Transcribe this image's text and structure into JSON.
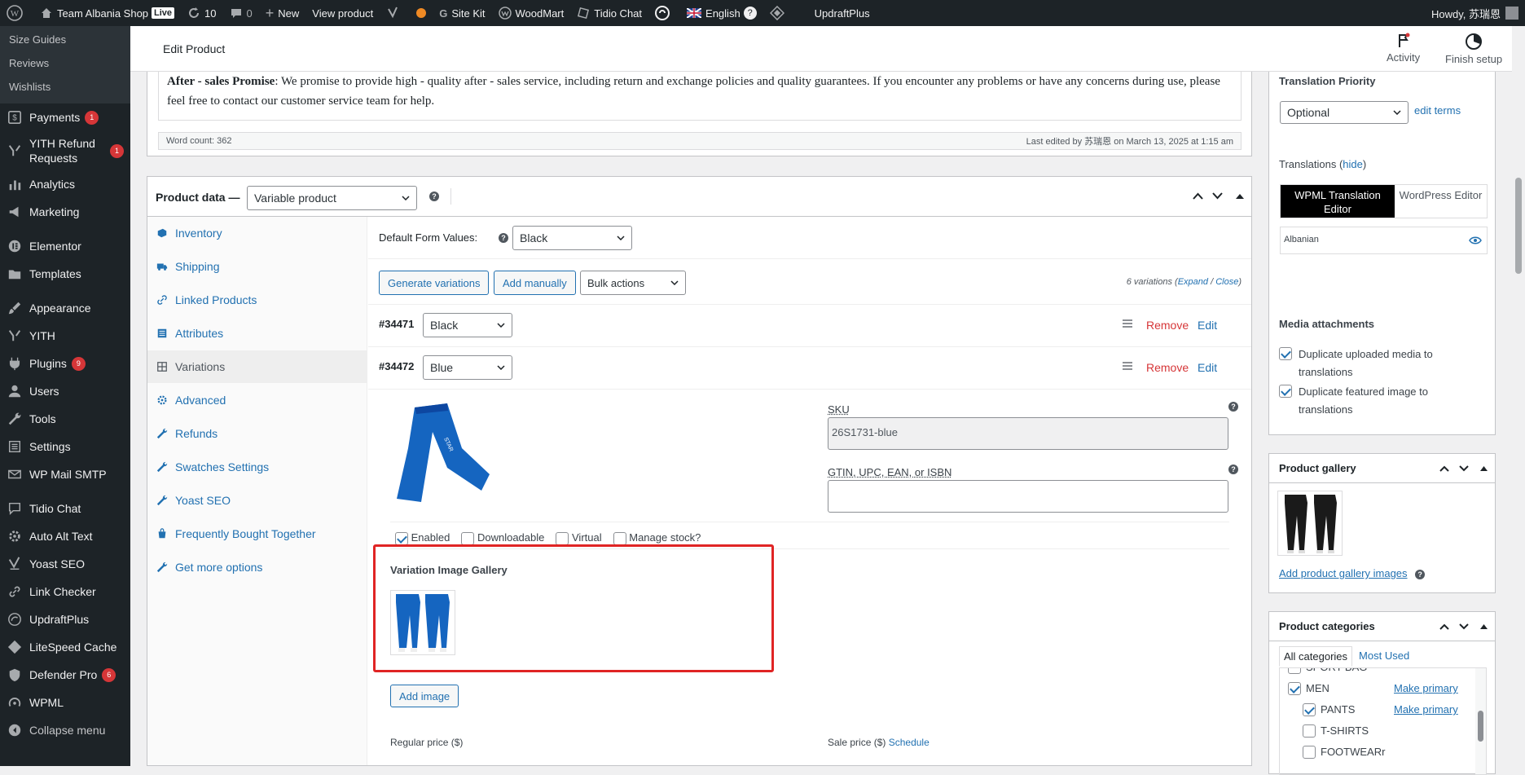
{
  "adminbar": {
    "site": "Team Albania Shop",
    "live": "Live",
    "updates": "10",
    "comments": "0",
    "new": "New",
    "view_product": "View product",
    "site_kit": "Site Kit",
    "woodmart": "WoodMart",
    "tidio": "Tidio Chat",
    "lang": "English",
    "updraft": "UpdraftPlus",
    "howdy": "Howdy, 苏瑞恩"
  },
  "sidebar": {
    "sub": [
      "Size Guides",
      "Reviews",
      "Wishlists"
    ],
    "items": [
      {
        "label": "Payments",
        "badge": "1",
        "icon": "payments-icon"
      },
      {
        "label": "YITH Refund Requests",
        "badge": "1",
        "icon": "yith-icon"
      },
      {
        "label": "Analytics",
        "badge": "",
        "icon": "analytics-icon"
      },
      {
        "label": "Marketing",
        "badge": "",
        "icon": "megaphone-icon"
      },
      {
        "label": "Elementor",
        "badge": "",
        "icon": "elementor-icon"
      },
      {
        "label": "Templates",
        "badge": "",
        "icon": "folder-icon"
      },
      {
        "label": "Appearance",
        "badge": "",
        "icon": "brush-icon"
      },
      {
        "label": "YITH",
        "badge": "",
        "icon": "yith-icon"
      },
      {
        "label": "Plugins",
        "badge": "9",
        "icon": "plug-icon"
      },
      {
        "label": "Users",
        "badge": "",
        "icon": "user-icon"
      },
      {
        "label": "Tools",
        "badge": "",
        "icon": "wrench-icon"
      },
      {
        "label": "Settings",
        "badge": "",
        "icon": "settings-icon"
      },
      {
        "label": "WP Mail SMTP",
        "badge": "",
        "icon": "mail-icon"
      },
      {
        "label": "Tidio Chat",
        "badge": "",
        "icon": "chat-icon"
      },
      {
        "label": "Auto Alt Text",
        "badge": "",
        "icon": "gear-icon"
      },
      {
        "label": "Yoast SEO",
        "badge": "",
        "icon": "yoast-icon"
      },
      {
        "label": "Link Checker",
        "badge": "",
        "icon": "link-icon"
      },
      {
        "label": "UpdraftPlus",
        "badge": "",
        "icon": "updraft-icon"
      },
      {
        "label": "LiteSpeed Cache",
        "badge": "",
        "icon": "diamond-icon"
      },
      {
        "label": "Defender Pro",
        "badge": "6",
        "icon": "shield-icon"
      },
      {
        "label": "WPML",
        "badge": "",
        "icon": "wpml-icon"
      },
      {
        "label": "Collapse menu",
        "badge": "",
        "icon": "collapse-icon"
      }
    ]
  },
  "topbar": {
    "title": "Edit Product",
    "activity": "Activity",
    "finish": "Finish setup"
  },
  "editor": {
    "promise_bold": "After - sales Promise",
    "promise_text": ": We promise to provide high - quality after - sales service, including return and exchange policies and quality guarantees. If you encounter any problems or have any concerns during use, please feel free to contact our customer service team for help.",
    "word_count": "Word count: 362",
    "last_edited": "Last edited by 苏瑞恩 on March 13, 2025 at 1:15 am"
  },
  "product_data": {
    "label": "Product data —",
    "type": "Variable product",
    "tabs": [
      {
        "label": "Inventory",
        "icon": "inventory-icon"
      },
      {
        "label": "Shipping",
        "icon": "truck-icon"
      },
      {
        "label": "Linked Products",
        "icon": "link-icon"
      },
      {
        "label": "Attributes",
        "icon": "list-icon"
      },
      {
        "label": "Variations",
        "icon": "grid-icon"
      },
      {
        "label": "Advanced",
        "icon": "gear-icon"
      },
      {
        "label": "Refunds",
        "icon": "wrench-icon"
      },
      {
        "label": "Swatches Settings",
        "icon": "wrench-icon"
      },
      {
        "label": "Yoast SEO",
        "icon": "wrench-icon"
      },
      {
        "label": "Frequently Bought Together",
        "icon": "bag-icon"
      },
      {
        "label": "Get more options",
        "icon": "wrench-icon"
      }
    ],
    "default_form": "Default Form Values:",
    "default_value": "Black",
    "generate": "Generate variations",
    "add_manually": "Add manually",
    "bulk": "Bulk actions",
    "count_text": "6 variations",
    "expand": "Expand",
    "sep": "/",
    "close": "Close",
    "paren_open": "(",
    "paren_close": ")",
    "variations": [
      {
        "id": "#34471",
        "value": "Black"
      },
      {
        "id": "#34472",
        "value": "Blue"
      }
    ],
    "remove": "Remove",
    "edit": "Edit",
    "sku_label": "SKU",
    "sku_value": "26S1731-blue",
    "gtin_label": "GTIN, UPC, EAN, or ISBN",
    "enabled": "Enabled",
    "downloadable": "Downloadable",
    "virtual": "Virtual",
    "manage_stock": "Manage stock?",
    "gallery_title": "Variation Image Gallery",
    "add_image": "Add image",
    "regular_price": "Regular price ($)",
    "sale_price": "Sale price ($)",
    "schedule": "Schedule"
  },
  "right": {
    "translation_priority": "Translation Priority",
    "priority_value": "Optional",
    "edit_terms": "edit terms",
    "translations": "Translations",
    "hide": "hide",
    "wpml_editor": "WPML Translation Editor",
    "wp_editor": "WordPress Editor",
    "albanian": "Albanian",
    "media_title": "Media attachments",
    "dup_media": "Duplicate uploaded media to translations",
    "dup_featured": "Duplicate featured image to translations",
    "gallery_title": "Product gallery",
    "add_gallery": "Add product gallery images",
    "cat_title": "Product categories",
    "all_cats": "All categories",
    "most_used": "Most Used",
    "cats": [
      {
        "label": "SPORT BAG",
        "checked": false,
        "primary": ""
      },
      {
        "label": "MEN",
        "checked": true,
        "primary": "Make primary"
      },
      {
        "label": "PANTS",
        "checked": true,
        "primary": "Make primary"
      },
      {
        "label": "T-SHIRTS",
        "checked": false,
        "primary": ""
      },
      {
        "label": "FOOTWEARr",
        "checked": false,
        "primary": ""
      }
    ]
  },
  "colors": {
    "accent": "#2271b1",
    "danger": "#d63638",
    "highlight": "#e02424",
    "product_blue": "#1565c0"
  }
}
